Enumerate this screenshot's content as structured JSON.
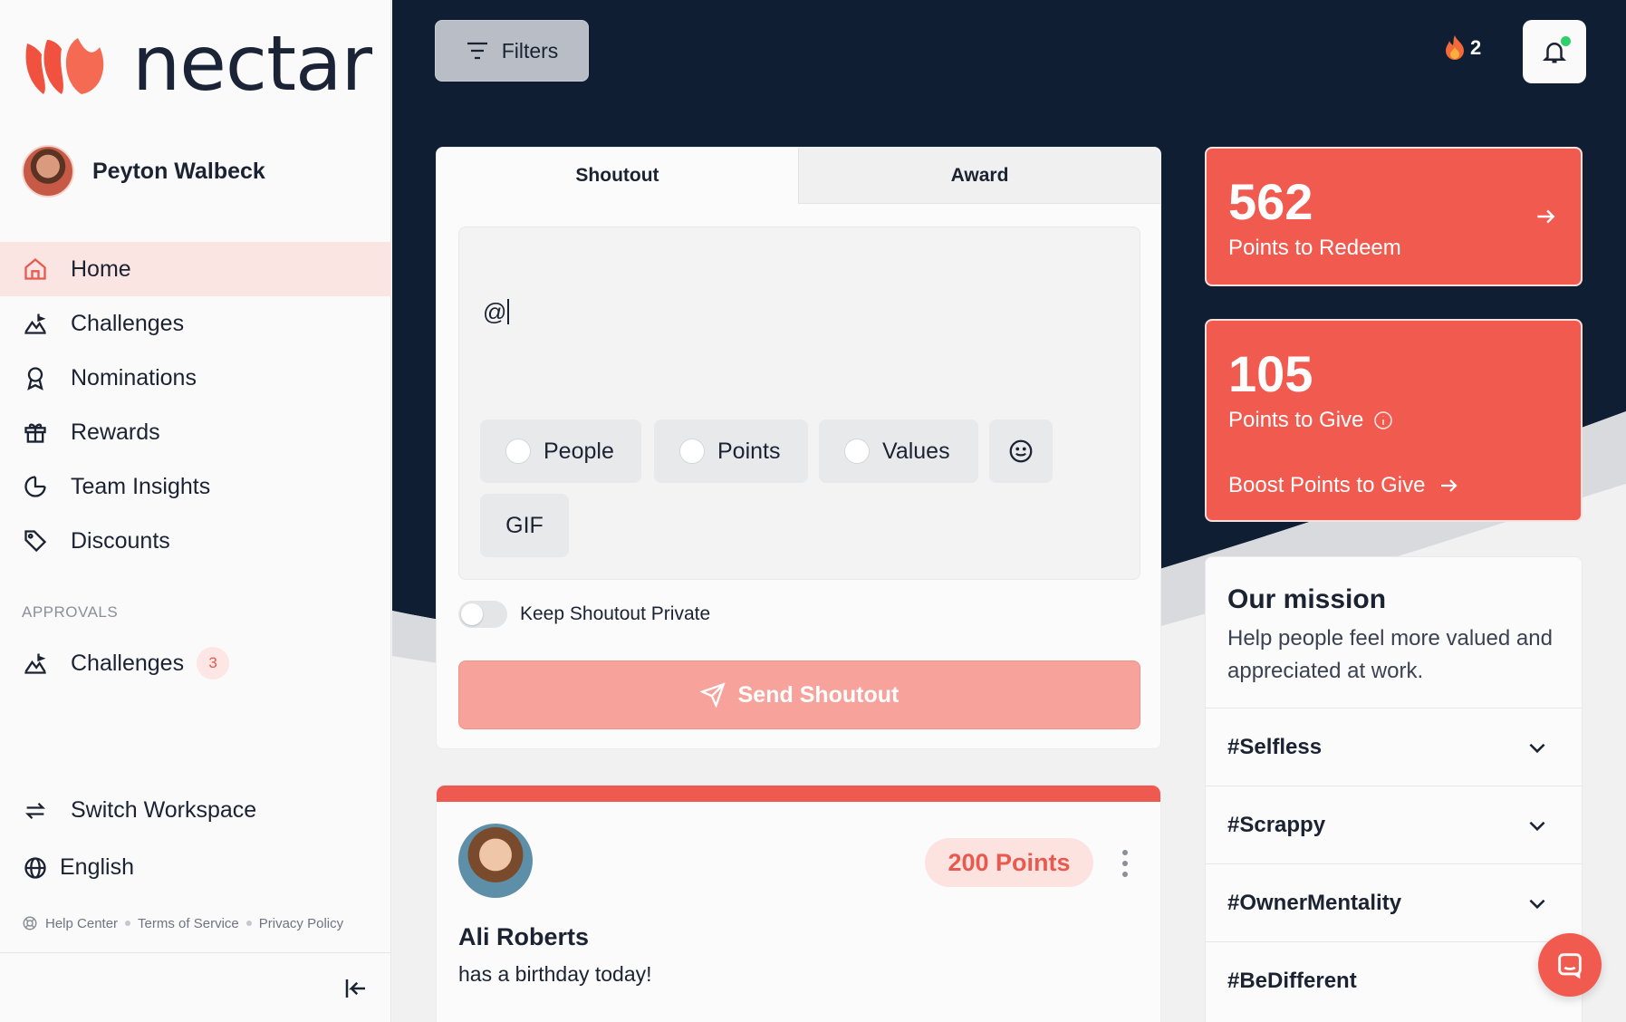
{
  "brand": {
    "name": "nectar",
    "accent": "#f15b4f",
    "navy": "#0f1e33"
  },
  "user": {
    "name": "Peyton Walbeck"
  },
  "sidebar": {
    "items": [
      {
        "label": "Home",
        "icon": "home-icon",
        "active": true
      },
      {
        "label": "Challenges",
        "icon": "chart-mountain-icon"
      },
      {
        "label": "Nominations",
        "icon": "ribbon-icon"
      },
      {
        "label": "Rewards",
        "icon": "gift-icon"
      },
      {
        "label": "Team Insights",
        "icon": "pie-chart-icon"
      },
      {
        "label": "Discounts",
        "icon": "tag-icon"
      }
    ],
    "approvals_label": "APPROVALS",
    "approvals": [
      {
        "label": "Challenges",
        "badge": "3",
        "icon": "chart-mountain-icon"
      }
    ],
    "bottom": [
      {
        "label": "Switch Workspace",
        "icon": "switch-icon"
      },
      {
        "label": "English",
        "icon": "globe-icon"
      }
    ],
    "footer": [
      "Help Center",
      "Terms of Service",
      "Privacy Policy"
    ]
  },
  "header": {
    "filters_label": "Filters",
    "streak_count": "2"
  },
  "composer": {
    "tabs": [
      "Shoutout",
      "Award"
    ],
    "typed_text": "@",
    "chips": [
      "People",
      "Points",
      "Values"
    ],
    "gif_label": "GIF",
    "private_label": "Keep Shoutout Private",
    "send_label": "Send Shoutout"
  },
  "post": {
    "points": "200 Points",
    "name": "Ali Roberts",
    "message": "has a birthday today!"
  },
  "cards": {
    "redeem": {
      "value": "562",
      "label": "Points to Redeem"
    },
    "give": {
      "value": "105",
      "label": "Points to Give",
      "boost_label": "Boost Points to Give"
    }
  },
  "mission": {
    "title": "Our mission",
    "text": "Help people feel more valued and appreciated at work.",
    "values": [
      "#Selfless",
      "#Scrappy",
      "#OwnerMentality",
      "#BeDifferent"
    ]
  }
}
